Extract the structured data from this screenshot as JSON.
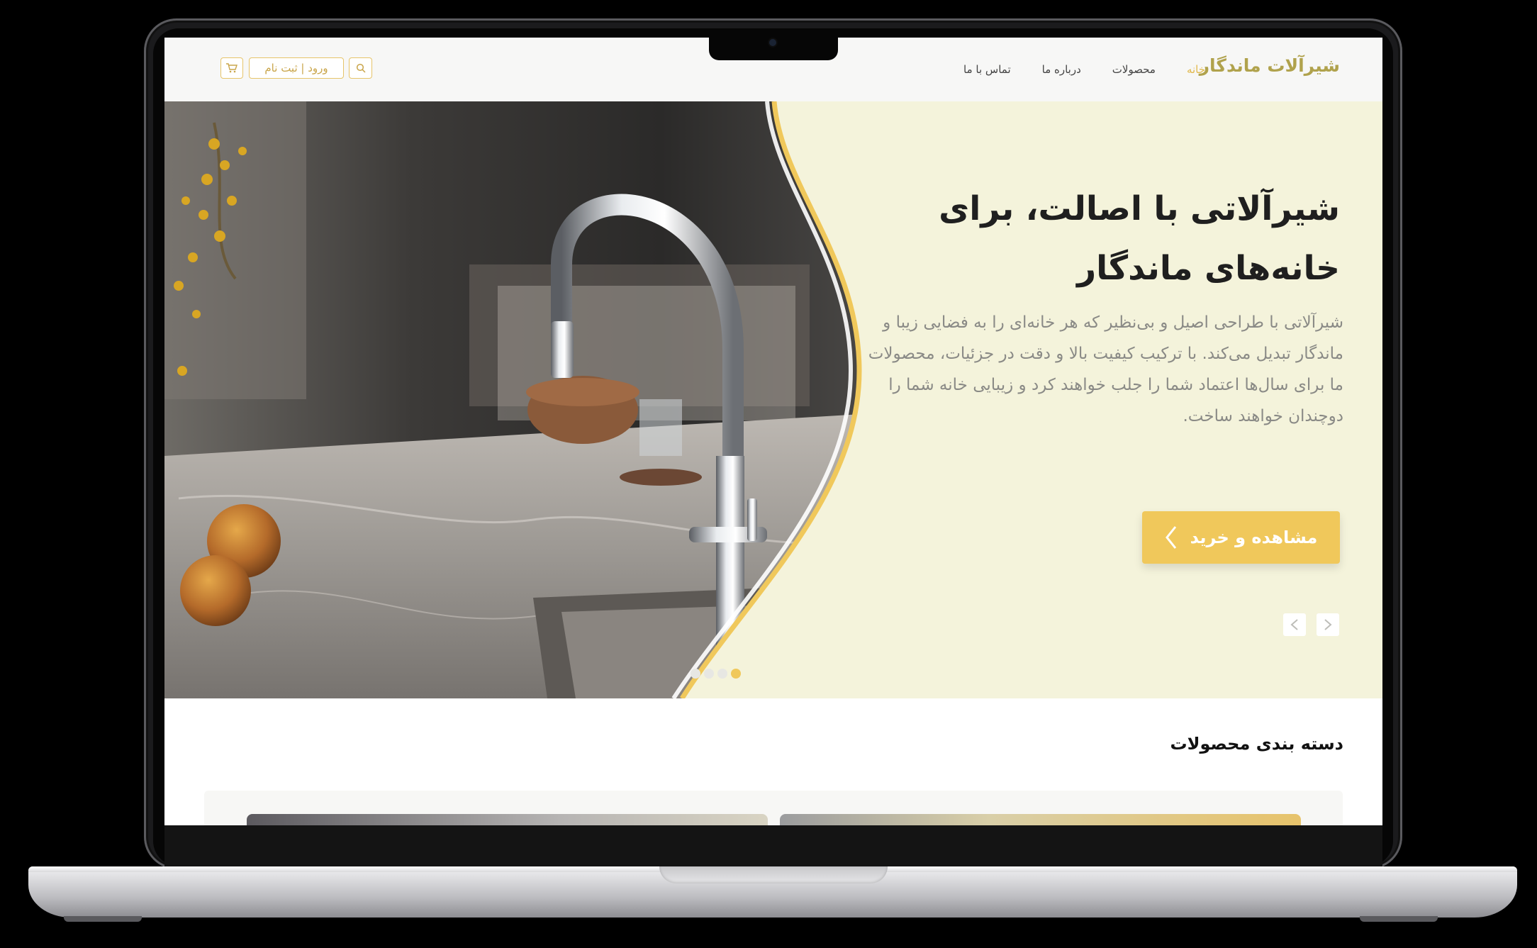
{
  "header": {
    "logo": "شیرآلات ماندگار",
    "nav": [
      {
        "label": "خانه",
        "active": true
      },
      {
        "label": "محصولات",
        "active": false
      },
      {
        "label": "درباره ما",
        "active": false
      },
      {
        "label": "تماس با ما",
        "active": false
      }
    ],
    "auth_label": "ورود | ثبت نام",
    "search_icon": "search-icon",
    "cart_icon": "cart-icon"
  },
  "hero": {
    "title": "شیرآلاتی با اصالت، برای خانه‌های ماندگار",
    "description": "شیرآلاتی با طراحی اصیل و بی‌نظیر که هر خانه‌ای را به فضایی زیبا و ماندگار تبدیل می‌کند. با ترکیب کیفیت بالا و دقت در جزئیات، محصولات ما برای سال‌ها اعتماد شما را جلب خواهند کرد و زیبایی خانه شما را دوچندان خواهند ساخت.",
    "cta_label": "مشاهده و خرید",
    "slides_total": 4,
    "active_slide": 1
  },
  "categories": {
    "title": "دسته بندی محصولات"
  },
  "colors": {
    "accent": "#f0c85b",
    "hero_bg": "#f4f3db",
    "logo": "#b0a24c"
  }
}
